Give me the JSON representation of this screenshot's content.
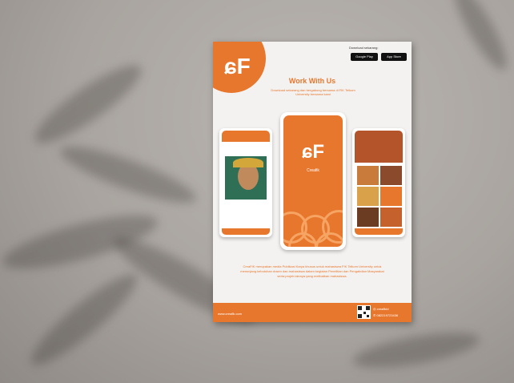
{
  "poster": {
    "title": "Work With Us",
    "subtitle": "Download sekarang dan bergabung bersama di FIK Telkom University bersama kami",
    "download_label": "Download sekarang:",
    "google_play": "Google Play",
    "app_store": "App Store",
    "app_name": "Creafik",
    "body_text": "CreaFIK merupakan media Publikasi Karya khusus untuk mahasiswa FIK Telkom University untuk menunjang kebutuhan dosen dan mahasiswa dalam kegiatan Penelitian dan Pengabdian Masyarakat serta projek lainnya yang melibatkan mahasiswa.",
    "website": "www.creafik.com",
    "instagram": "creafikid",
    "phone": "082219723436"
  },
  "colors": {
    "brand_orange": "#e8772e",
    "background": "#a8a39f",
    "paper": "#f4f2f0"
  }
}
